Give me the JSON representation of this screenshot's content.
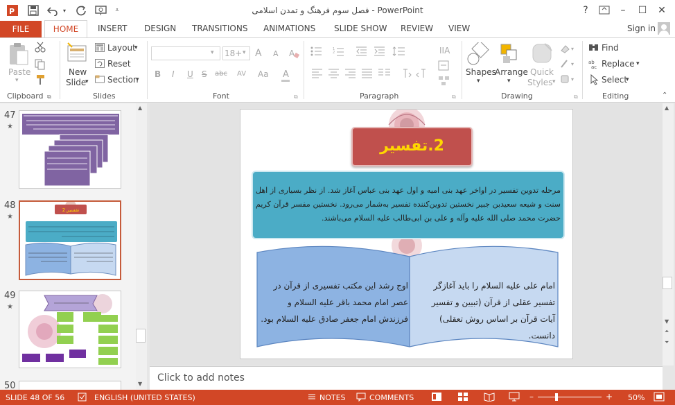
{
  "window": {
    "title": "فصل سوم فرهنگ و تمدن اسلامی - PowerPoint",
    "help": "?",
    "minimize": "–",
    "maximize": "☐",
    "close": "✕",
    "restore": "⧉"
  },
  "tabs": {
    "file": "FILE",
    "home": "HOME",
    "insert": "INSERT",
    "design": "DESIGN",
    "transitions": "TRANSITIONS",
    "animations": "ANIMATIONS",
    "slideshow": "SLIDE SHOW",
    "review": "REVIEW",
    "view": "VIEW",
    "signin": "Sign in"
  },
  "ribbon": {
    "clipboard": {
      "paste": "Paste",
      "label": "Clipboard"
    },
    "slides": {
      "new_slide": "New",
      "new_slide2": "Slide",
      "layout": "Layout",
      "reset": "Reset",
      "section": "Section",
      "label": "Slides"
    },
    "font": {
      "size": "18+",
      "bold": "B",
      "italic": "I",
      "underline": "U",
      "strike": "S",
      "abc": "abc",
      "av": "AV",
      "aa": "Aa",
      "a": "A",
      "label": "Font"
    },
    "paragraph": {
      "label": "Paragraph"
    },
    "drawing": {
      "shapes": "Shapes",
      "arrange": "Arrange",
      "quick": "Quick",
      "styles": "Styles",
      "label": "Drawing"
    },
    "editing": {
      "find": "Find",
      "replace": "Replace",
      "select": "Select",
      "label": "Editing"
    }
  },
  "thumbnails": [
    {
      "num": "47",
      "star": "★"
    },
    {
      "num": "48",
      "star": "★",
      "title": "2.تفسیر"
    },
    {
      "num": "49",
      "star": "★"
    },
    {
      "num": "50"
    }
  ],
  "slide": {
    "title": "2.تفسیر",
    "intro": "مرحله تدوین تفسیر در اواخر عهد بنی امیه و اول عهد بنی عباس آغاز شد. از نظر بسیاری از اهل سنت و شیعه سعیدبن جبیر نخستین تدوین‌کننده تفسیر به‌شمار می‌رود. نخستین مفسر قرآن کریم حضرت محمد صلی الله علیه وآله و علی بن ابی‌طالب علیه السلام می‌باشند.",
    "right_page": "امام علی علیه السلام را باید آغازگر تفسیر عقلی از قرآن (تبیین و تفسیر آیات قرآن بر اساس روش تعقلی) دانست.",
    "left_page": "اوج رشد این مکتب تفسیری از قرآن در عصر امام محمد باقر علیه السلام و فرزندش امام جعفر صادق علیه السلام بود."
  },
  "notes": {
    "placeholder": "Click to add notes"
  },
  "status": {
    "slide": "SLIDE 48 OF 56",
    "language": "ENGLISH (UNITED STATES)",
    "notes": "NOTES",
    "comments": "COMMENTS",
    "zoom": "50%",
    "zoom_minus": "–",
    "zoom_plus": "+"
  },
  "colors": {
    "accent": "#d24726",
    "title_box": "#c0504d",
    "title_text": "#ffd700",
    "intro_box": "#4bacc6",
    "book_left": "#8db3e2",
    "book_right": "#c6d9f1"
  }
}
